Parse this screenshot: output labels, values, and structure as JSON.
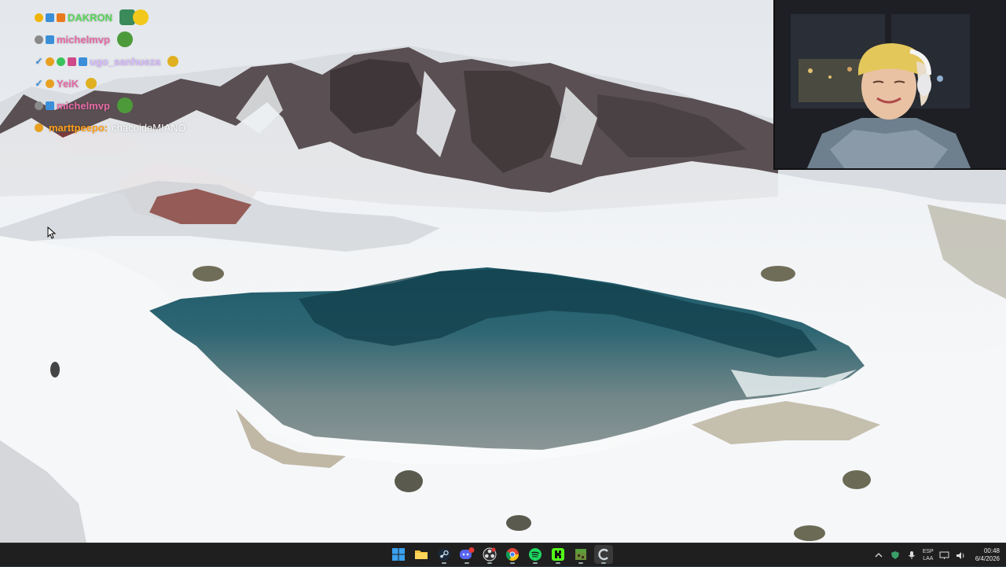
{
  "chat": {
    "messages": [
      {
        "user": "DAKRON",
        "user_color": "#5bd65b",
        "badges": [
          "#f0b400",
          "#3b8fd9",
          "#e87a1e"
        ],
        "text": ""
      },
      {
        "user": "michelmvp",
        "user_color": "#e86aa8",
        "badges": [
          "#8a8a8a",
          "#3b8fd9"
        ],
        "text": ""
      },
      {
        "user": "ugo_sanhueza",
        "user_color": "#d7b8ff",
        "badges": [
          "#3b8fd9",
          "#e8a020",
          "#3bc45a",
          "#d04a8a"
        ],
        "text": ""
      },
      {
        "user": "YeiK",
        "user_color": "#e86aa8",
        "badges": [
          "#e8a020"
        ],
        "text": ""
      },
      {
        "user": "michelmvp",
        "user_color": "#e86aa8",
        "badges": [
          "#8a8a8a",
          "#3b8fd9"
        ],
        "text": ""
      },
      {
        "user": "marttpeepo:",
        "user_color": "#ff9f1a",
        "badges": [
          "#e8a020"
        ],
        "text": "chacoideMIANO"
      }
    ]
  },
  "taskbar": {
    "apps": [
      {
        "name": "windows-start-icon",
        "active": false
      },
      {
        "name": "file-explorer-icon",
        "active": false
      },
      {
        "name": "steam-icon",
        "active": false
      },
      {
        "name": "discord-icon",
        "active": false,
        "badge": "99"
      },
      {
        "name": "obs-icon",
        "active": false
      },
      {
        "name": "chrome-icon",
        "active": false
      },
      {
        "name": "spotify-icon",
        "active": false
      },
      {
        "name": "kick-icon",
        "active": false
      },
      {
        "name": "minecraft-icon",
        "active": false
      },
      {
        "name": "app-c-icon",
        "active": true
      }
    ],
    "tray": {
      "language_top": "ESP",
      "language_bottom": "LAA",
      "time": "00:48",
      "date": "6/4/2026"
    }
  },
  "colors": {
    "taskbar_bg": "#1f1f1f",
    "lake": "#2d5e6b",
    "snow": "#f2f4f6"
  }
}
